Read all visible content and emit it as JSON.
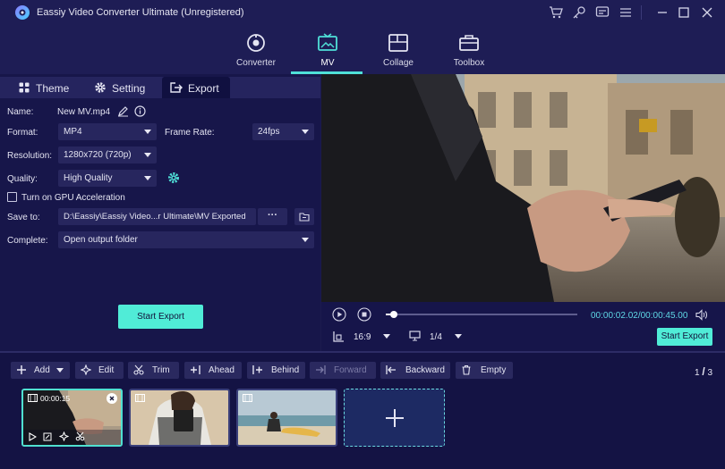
{
  "app": {
    "title": "Eassiy Video Converter Ultimate (Unregistered)"
  },
  "titlebar_icons": [
    "cart-icon",
    "key-icon",
    "feedback-icon",
    "menu-icon",
    "minimize-icon",
    "maximize-icon",
    "close-icon"
  ],
  "nav": {
    "items": [
      {
        "label": "Converter",
        "icon": "converter-icon"
      },
      {
        "label": "MV",
        "icon": "mv-icon",
        "active": true
      },
      {
        "label": "Collage",
        "icon": "collage-icon"
      },
      {
        "label": "Toolbox",
        "icon": "toolbox-icon"
      }
    ]
  },
  "tabs": {
    "theme": "Theme",
    "setting": "Setting",
    "export": "Export",
    "active": "export"
  },
  "export": {
    "name_label": "Name:",
    "name_value": "New MV.mp4",
    "format_label": "Format:",
    "format_value": "MP4",
    "frame_rate_label": "Frame Rate:",
    "frame_rate_value": "24fps",
    "resolution_label": "Resolution:",
    "resolution_value": "1280x720 (720p)",
    "quality_label": "Quality:",
    "quality_value": "High Quality",
    "gpu_label": "Turn on GPU Acceleration",
    "gpu_checked": false,
    "save_to_label": "Save to:",
    "save_to_value": "D:\\Eassiy\\Eassiy Video...r Ultimate\\MV Exported",
    "browse_label": "···",
    "complete_label": "Complete:",
    "complete_value": "Open output folder",
    "start_export_label": "Start Export"
  },
  "player": {
    "time": "00:00:02.02/00:00:45.00",
    "progress": 0.04,
    "ratio_value": "16:9",
    "screen_value": "1/4",
    "start_export_label": "Start Export"
  },
  "toolbar": {
    "add": "Add",
    "edit": "Edit",
    "trim": "Trim",
    "ahead": "Ahead",
    "behind": "Behind",
    "forward": "Forward",
    "backward": "Backward",
    "empty": "Empty",
    "page_current": "1",
    "page_sep": "/",
    "page_total": "3"
  },
  "clips": [
    {
      "duration": "00:00:15",
      "selected": true
    },
    {
      "duration": "",
      "selected": false
    },
    {
      "duration": "",
      "selected": false
    }
  ],
  "colors": {
    "accent": "#50ecd7",
    "background": "#1b1a4e",
    "panel": "#17164a"
  }
}
